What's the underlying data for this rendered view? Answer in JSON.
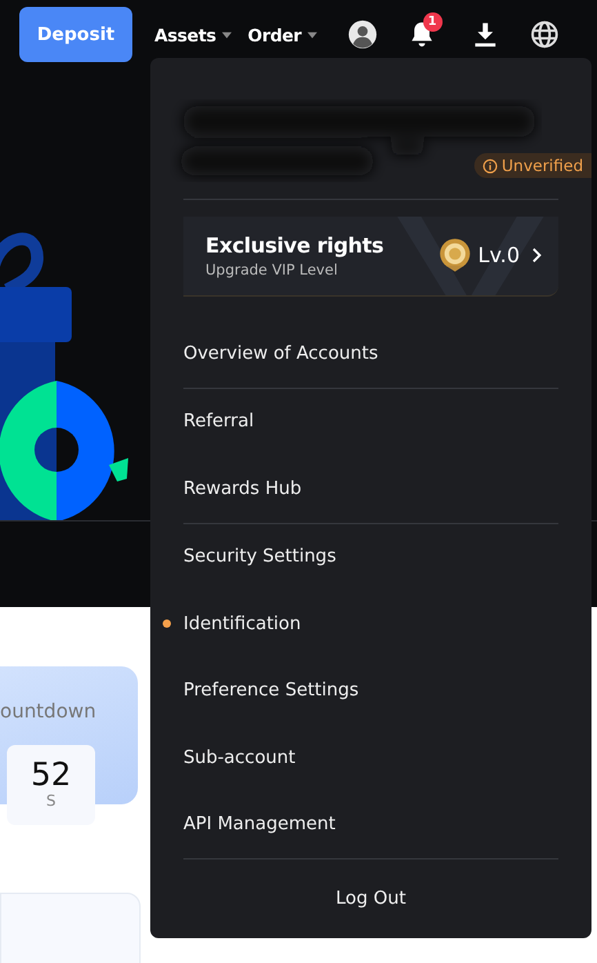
{
  "top_bar": {
    "deposit": "Deposit",
    "menus": [
      {
        "label": "Assets"
      },
      {
        "label": "Order"
      }
    ],
    "notification_badge": "1"
  },
  "countdown": {
    "label": "ountdown",
    "value": "52",
    "unit": "S"
  },
  "account_menu": {
    "status_badge": "Unverified",
    "vip": {
      "title": "Exclusive rights",
      "subtitle": "Upgrade VIP Level",
      "level": "Lv.0"
    },
    "items": [
      {
        "label": "Overview of Accounts",
        "dot": false,
        "divider_after": true
      },
      {
        "label": "Referral",
        "dot": false,
        "divider_after": false
      },
      {
        "label": "Rewards Hub",
        "dot": false,
        "divider_after": true
      },
      {
        "label": "Security Settings",
        "dot": false,
        "divider_after": false
      },
      {
        "label": "Identification",
        "dot": true,
        "divider_after": false
      },
      {
        "label": "Preference Settings",
        "dot": false,
        "divider_after": false
      },
      {
        "label": "Sub-account",
        "dot": false,
        "divider_after": false
      },
      {
        "label": "API Management",
        "dot": false,
        "divider_after": true
      }
    ],
    "logout": "Log Out"
  }
}
